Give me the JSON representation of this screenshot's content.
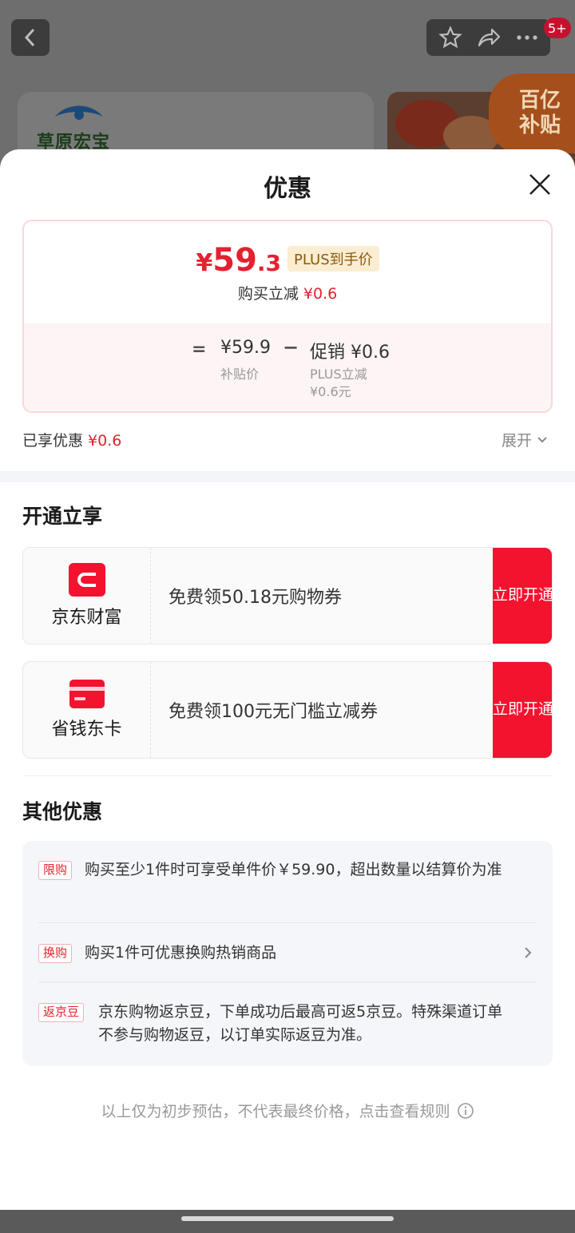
{
  "background": {
    "badge": "5+",
    "brand_logo": "草原宏宝",
    "subsidy_badge_line1": "百亿",
    "subsidy_badge_line2": "补贴"
  },
  "sheet": {
    "title": "优惠"
  },
  "price": {
    "yen": "¥",
    "integer": "59",
    "decimal": ".3",
    "plus_tag": "PLUS到手价",
    "sub_label": "购买立减",
    "sub_value": "¥0.6",
    "calc_eq": "=",
    "calc_base": "¥59.9",
    "calc_base_label": "补贴价",
    "calc_minus": "−",
    "calc_promo": "促销 ¥0.6",
    "calc_plus_label": "PLUS立减",
    "calc_plus_value": "¥0.6元"
  },
  "enjoyed": {
    "label": "已享优惠",
    "value": "¥0.6",
    "expand": "展开"
  },
  "members": {
    "title": "开通立享",
    "items": [
      {
        "name": "京东财富",
        "desc": "免费领50.18元购物券",
        "button": "立即开通"
      },
      {
        "name": "省钱东卡",
        "desc": "免费领100元无门槛立减券",
        "button": "立即开通"
      }
    ]
  },
  "other": {
    "title": "其他优惠",
    "items": [
      {
        "tag": "限购",
        "text": "购买至少1件时可享受单件价￥59.90，超出数量以结算价为准"
      },
      {
        "tag": "换购",
        "text": "购买1件可优惠换购热销商品"
      },
      {
        "tag": "返京豆",
        "text": "京东购物返京豆，下单成功后最高可返5京豆。特殊渠道订单不参与购物返豆，以订单实际返豆为准。"
      }
    ]
  },
  "footer": {
    "note": "以上仅为初步预估，不代表最终价格，点击查看规则"
  },
  "colors": {
    "accent_red": "#e3212f",
    "button_red": "#f3132f",
    "plus_gold_bg": "#fbedd1"
  }
}
